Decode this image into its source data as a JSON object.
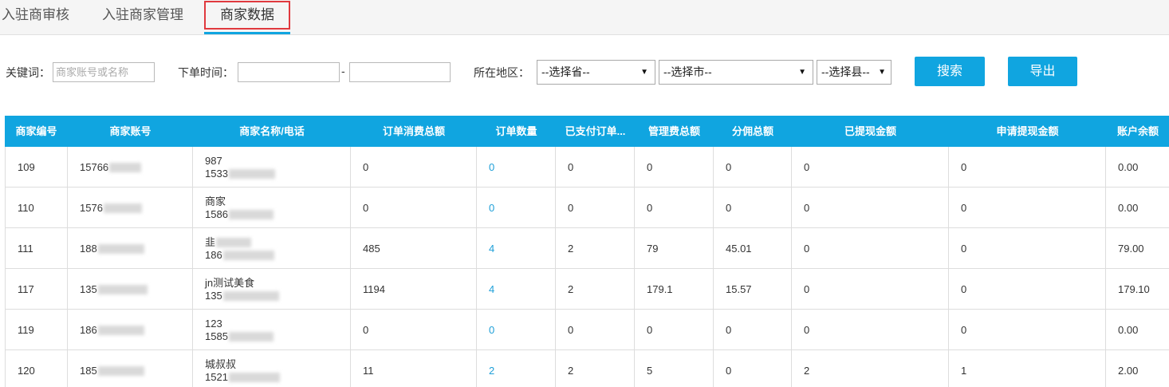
{
  "tabs": [
    {
      "label": "入驻商审核"
    },
    {
      "label": "入驻商家管理"
    },
    {
      "label": "商家数据"
    }
  ],
  "filters": {
    "keyword_label": "关键词：",
    "keyword_placeholder": "商家账号或名称",
    "order_time_label": "下单时间：",
    "date_separator": "-",
    "region_label": "所在地区：",
    "province": "--选择省--",
    "city": "--选择市--",
    "county": "--选择县--",
    "search_button": "搜索",
    "export_button": "导出"
  },
  "table": {
    "columns": [
      "商家编号",
      "商家账号",
      "商家名称/电话",
      "订单消费总额",
      "订单数量",
      "已支付订单...",
      "管理费总额",
      "分佣总额",
      "已提现金额",
      "申请提现金额",
      "账户余额"
    ],
    "rows": [
      {
        "id": "109",
        "account": "15766",
        "name": "987",
        "phone": "1533",
        "total": "0",
        "orders": "0",
        "paid": "0",
        "fee": "0",
        "commission": "0",
        "withdrawn": "0",
        "applied": "0",
        "balance": "0.00"
      },
      {
        "id": "110",
        "account": "1576",
        "name": "商家",
        "phone": "1586",
        "total": "0",
        "orders": "0",
        "paid": "0",
        "fee": "0",
        "commission": "0",
        "withdrawn": "0",
        "applied": "0",
        "balance": "0.00"
      },
      {
        "id": "111",
        "account": "188",
        "name": "韭",
        "phone": "186",
        "total": "485",
        "orders": "4",
        "paid": "2",
        "fee": "79",
        "commission": "45.01",
        "withdrawn": "0",
        "applied": "0",
        "balance": "79.00"
      },
      {
        "id": "117",
        "account": "135",
        "name": "jn测试美食",
        "phone": "135",
        "total": "1194",
        "orders": "4",
        "paid": "2",
        "fee": "179.1",
        "commission": "15.57",
        "withdrawn": "0",
        "applied": "0",
        "balance": "179.10"
      },
      {
        "id": "119",
        "account": "186",
        "name": "123",
        "phone": "1585",
        "total": "0",
        "orders": "0",
        "paid": "0",
        "fee": "0",
        "commission": "0",
        "withdrawn": "0",
        "applied": "0",
        "balance": "0.00"
      },
      {
        "id": "120",
        "account": "185",
        "name": "城叔叔",
        "phone": "1521",
        "total": "11",
        "orders": "2",
        "paid": "2",
        "fee": "5",
        "commission": "0",
        "withdrawn": "2",
        "applied": "1",
        "balance": "2.00"
      }
    ]
  }
}
